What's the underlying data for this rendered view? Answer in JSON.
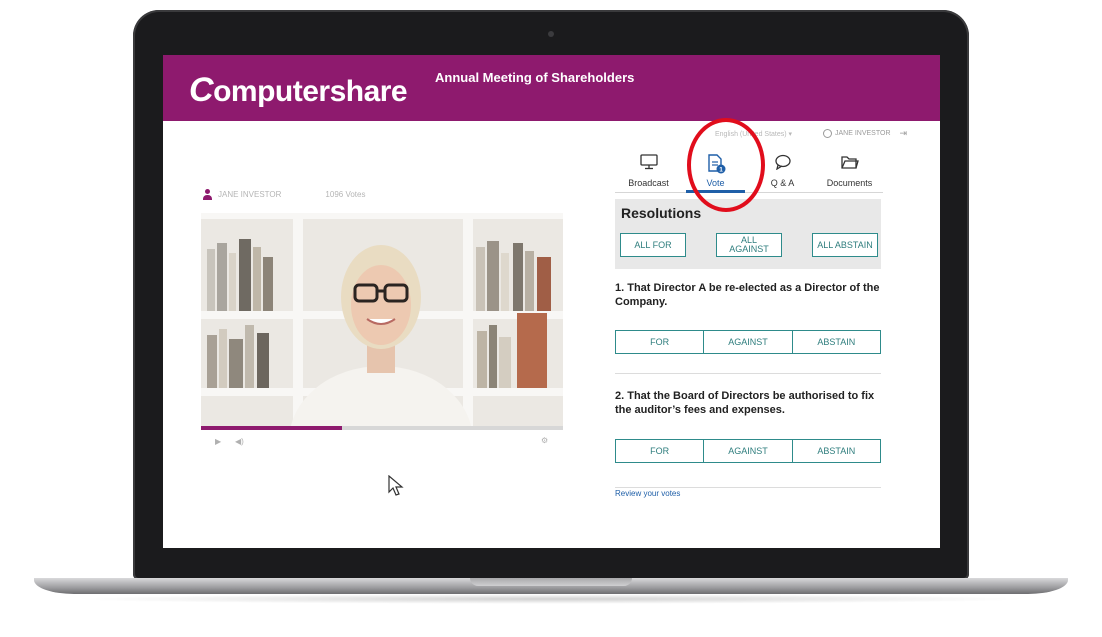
{
  "header": {
    "logo_text": "omputershare",
    "logo_initial": "C",
    "meeting_title": "Annual Meeting of Shareholders",
    "brand_color": "#8e1a6e"
  },
  "utility": {
    "language": "English (United States) ▾",
    "user_name": "JANE INVESTOR"
  },
  "viewer": {
    "name": "JANE INVESTOR",
    "votes": "1096 Votes",
    "progress": 0.39
  },
  "tabs": [
    {
      "label": "Broadcast",
      "icon": "monitor-icon"
    },
    {
      "label": "Vote",
      "icon": "document-icon",
      "badge": "1",
      "active": true
    },
    {
      "label": "Q & A",
      "icon": "chat-icon"
    },
    {
      "label": "Documents",
      "icon": "folder-icon"
    }
  ],
  "resolutions": {
    "title": "Resolutions",
    "all_for": "ALL FOR",
    "all_against": "ALL AGAINST",
    "all_abstain": "ALL ABSTAIN"
  },
  "questions": [
    {
      "text": "1. That Director A be re-elected as a Director of the Company.",
      "options": [
        "FOR",
        "AGAINST",
        "ABSTAIN"
      ]
    },
    {
      "text": "2. That the Board of Directors be authorised to fix the auditor’s fees and expenses.",
      "options": [
        "FOR",
        "AGAINST",
        "ABSTAIN"
      ]
    }
  ],
  "review_link": "Review your votes",
  "accent_color": "#1f5fa8",
  "button_color": "#2e8b8b",
  "highlight_color": "#e10d1c"
}
